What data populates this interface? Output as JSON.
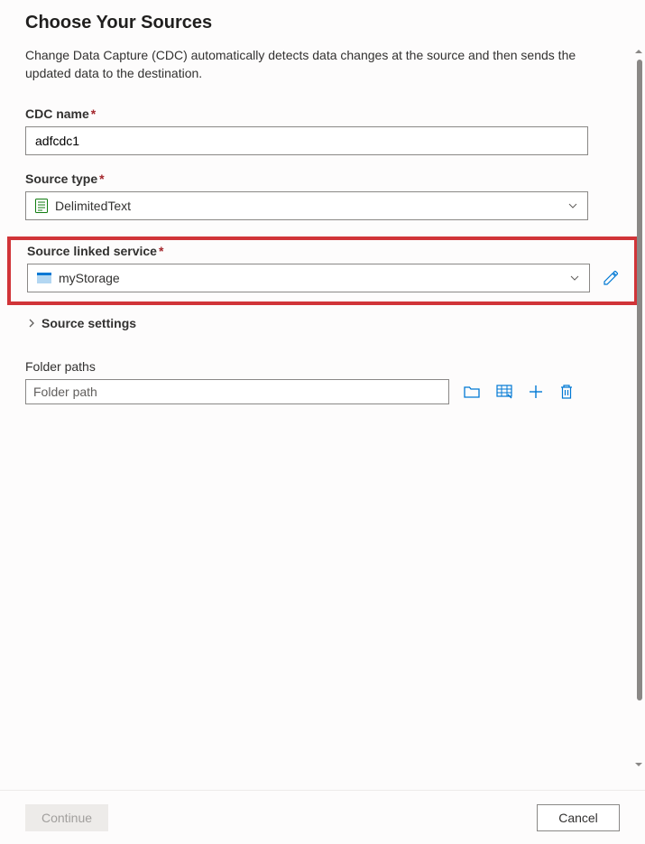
{
  "page": {
    "title": "Choose Your Sources",
    "description": "Change Data Capture (CDC) automatically detects data changes at the source and then sends the updated data to the destination."
  },
  "cdc_name": {
    "label": "CDC name",
    "value": "adfcdc1"
  },
  "source_type": {
    "label": "Source type",
    "value": "DelimitedText"
  },
  "linked_service": {
    "label": "Source linked service",
    "value": "myStorage"
  },
  "source_settings": {
    "label": "Source settings"
  },
  "folder_paths": {
    "label": "Folder paths",
    "placeholder": "Folder path"
  },
  "footer": {
    "continue_label": "Continue",
    "cancel_label": "Cancel"
  }
}
